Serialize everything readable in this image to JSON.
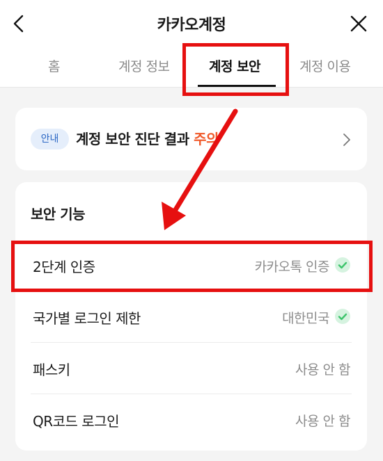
{
  "header": {
    "title": "카카오계정",
    "back_icon": "chevron-left-icon",
    "close_icon": "close-icon"
  },
  "tabs": [
    {
      "label": "홈",
      "active": false
    },
    {
      "label": "계정 정보",
      "active": false
    },
    {
      "label": "계정 보안",
      "active": true
    },
    {
      "label": "계정 이용",
      "active": false
    }
  ],
  "notice": {
    "badge": "안내",
    "text": "계정 보안 진단 결과 ",
    "status": "주의",
    "status_color": "#f0592a"
  },
  "security": {
    "section_title": "보안 기능",
    "rows": [
      {
        "label": "2단계 인증",
        "value": "카카오톡 인증",
        "checked": true
      },
      {
        "label": "국가별 로그인 제한",
        "value": "대한민국",
        "checked": true
      },
      {
        "label": "패스키",
        "value": "사용 안 함",
        "checked": false
      },
      {
        "label": "QR코드 로그인",
        "value": "사용 안 함",
        "checked": false
      }
    ]
  },
  "colors": {
    "highlight": "#e61010",
    "check": "#3cc46b",
    "badge_bg": "#e5eefb",
    "badge_text": "#2d68c4"
  }
}
